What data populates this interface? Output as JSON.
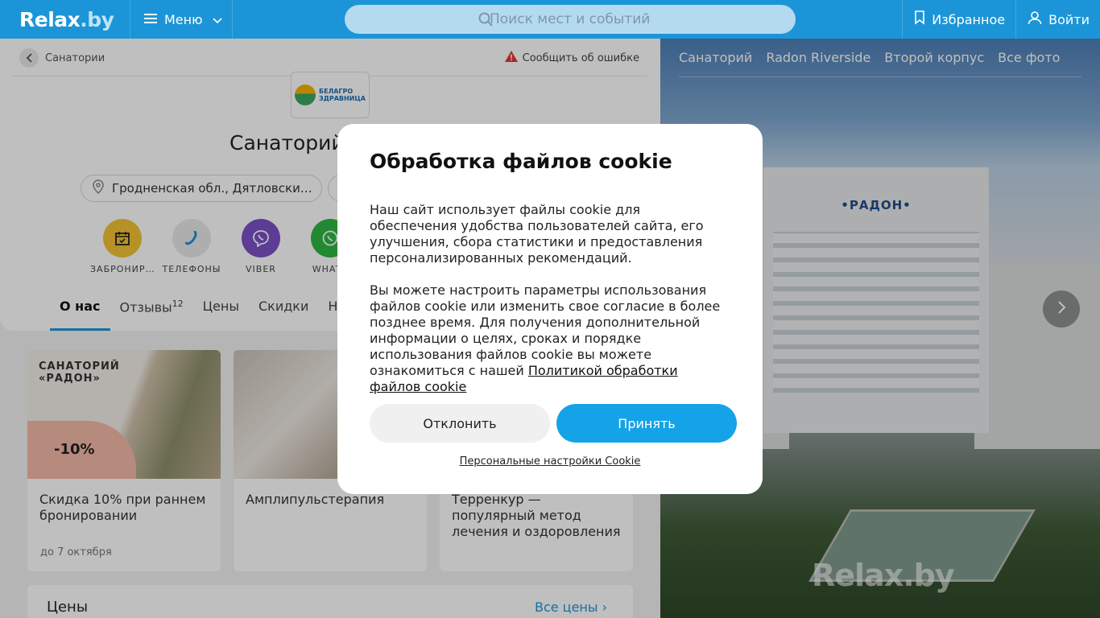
{
  "header": {
    "logo_text": "Relax",
    "logo_suffix": ".by",
    "menu_label": "Меню",
    "search_placeholder": "Поиск мест и событий",
    "favorites_label": "Избранное",
    "login_label": "Войти",
    "accent_color": "#1b95d7"
  },
  "breadcrumb": {
    "back_label": "Санатории",
    "report_label": "Сообщить об ошибке"
  },
  "brand_logo": {
    "line1": "БЕЛАГРО",
    "line2": "ЗДРАВНИЦА"
  },
  "page_title": "Санаторий",
  "address": "Гродненская обл., Дятловски…",
  "actions": [
    {
      "label": "ЗАБРОНИР…",
      "icon": "calendar-icon",
      "color": "#f3c333"
    },
    {
      "label": "ТЕЛЕФОНЫ",
      "icon": "phone-icon",
      "color": "#e9e9e9"
    },
    {
      "label": "VIBER",
      "icon": "viber-icon",
      "color": "#7b51c6"
    },
    {
      "label": "WHATS",
      "icon": "whatsapp-icon",
      "color": "#2db742"
    }
  ],
  "tabs": [
    {
      "label": "О нас",
      "badge": ""
    },
    {
      "label": "Отзывы",
      "badge": "12"
    },
    {
      "label": "Цены",
      "badge": ""
    },
    {
      "label": "Скидки",
      "badge": ""
    },
    {
      "label": "Но",
      "badge": ""
    }
  ],
  "promos": [
    {
      "brand_line1": "САНАТОРИЙ",
      "brand_line2": "«РАДОН»",
      "discount": "-10%",
      "title": "Скидка 10% при раннем бронировании",
      "subtitle": "до 7 октября"
    },
    {
      "title": "Амплипульстерапия",
      "subtitle": ""
    },
    {
      "title": "Терренкур — популярный метод лечения и оздоровления",
      "subtitle": ""
    }
  ],
  "prices_section": {
    "title": "Цены",
    "all_label": "Все цены"
  },
  "gallery": {
    "tabs": [
      "Санаторий",
      "Radon Riverside",
      "Второй корпус",
      "Все фото"
    ],
    "building_sign": "•РАДОН•",
    "watermark": "Relax.by"
  },
  "cookie_modal": {
    "title": "Обработка файлов cookie",
    "paragraph1": "Наш сайт использует файлы cookie для обеспечения удобства пользователей сайта, его улучшения, сбора статистики и предоставления персонализированных рекомендаций.",
    "paragraph2": "Вы можете настроить параметры использования файлов cookie или изменить свое согласие в более позднее время. Для получения дополнительной информации о целях, сроках и порядке использования файлов cookie вы можете ознакомиться с нашей ",
    "policy_link": "Политикой обработки файлов cookie",
    "decline_label": "Отклонить",
    "accept_label": "Принять",
    "personal_settings_label": "Персональные настройки Cookie"
  }
}
